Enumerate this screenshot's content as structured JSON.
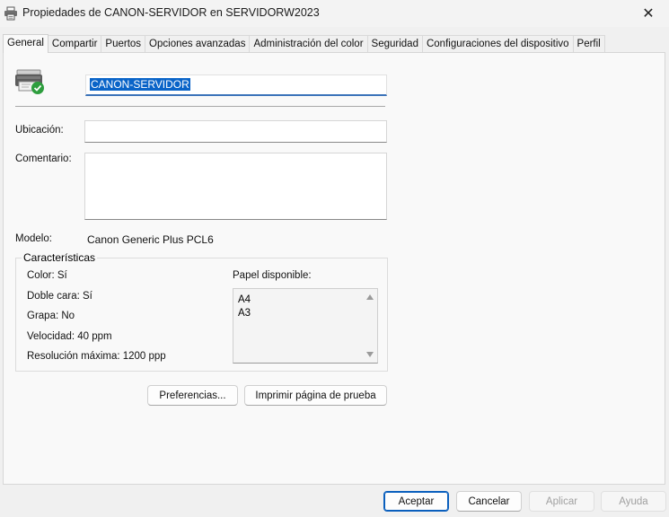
{
  "window": {
    "title": "Propiedades de CANON-SERVIDOR en SERVIDORW2023",
    "close_glyph": "✕"
  },
  "tabs": [
    {
      "label": "General",
      "active": true
    },
    {
      "label": "Compartir"
    },
    {
      "label": "Puertos"
    },
    {
      "label": "Opciones avanzadas"
    },
    {
      "label": "Administración del color"
    },
    {
      "label": "Seguridad"
    },
    {
      "label": "Configuraciones del dispositivo"
    },
    {
      "label": "Perfil"
    }
  ],
  "general": {
    "printer_name": "CANON-SERVIDOR",
    "location_label": "Ubicación:",
    "location_value": "",
    "comment_label": "Comentario:",
    "comment_value": "",
    "model_label": "Modelo:",
    "model_value": "Canon Generic Plus PCL6"
  },
  "features": {
    "title": "Características",
    "color": "Color: Sí",
    "duplex": "Doble cara: Sí",
    "staple": "Grapa: No",
    "speed": "Velocidad: 40 ppm",
    "resolution": "Resolución máxima: 1200 ppp",
    "paper_label": "Papel disponible:",
    "paper_sizes": [
      "A4",
      "A3"
    ]
  },
  "buttons": {
    "preferences": "Preferencias...",
    "print_test": "Imprimir página de prueba",
    "ok": "Aceptar",
    "cancel": "Cancelar",
    "apply": "Aplicar",
    "help": "Ayuda"
  },
  "colors": {
    "accent": "#0a5fbd",
    "selection": "#0a64c8",
    "status_ok": "#2e9e3e"
  },
  "icons": {
    "title": "printer-icon",
    "printer": "printer-ready-icon",
    "close": "close-icon"
  }
}
